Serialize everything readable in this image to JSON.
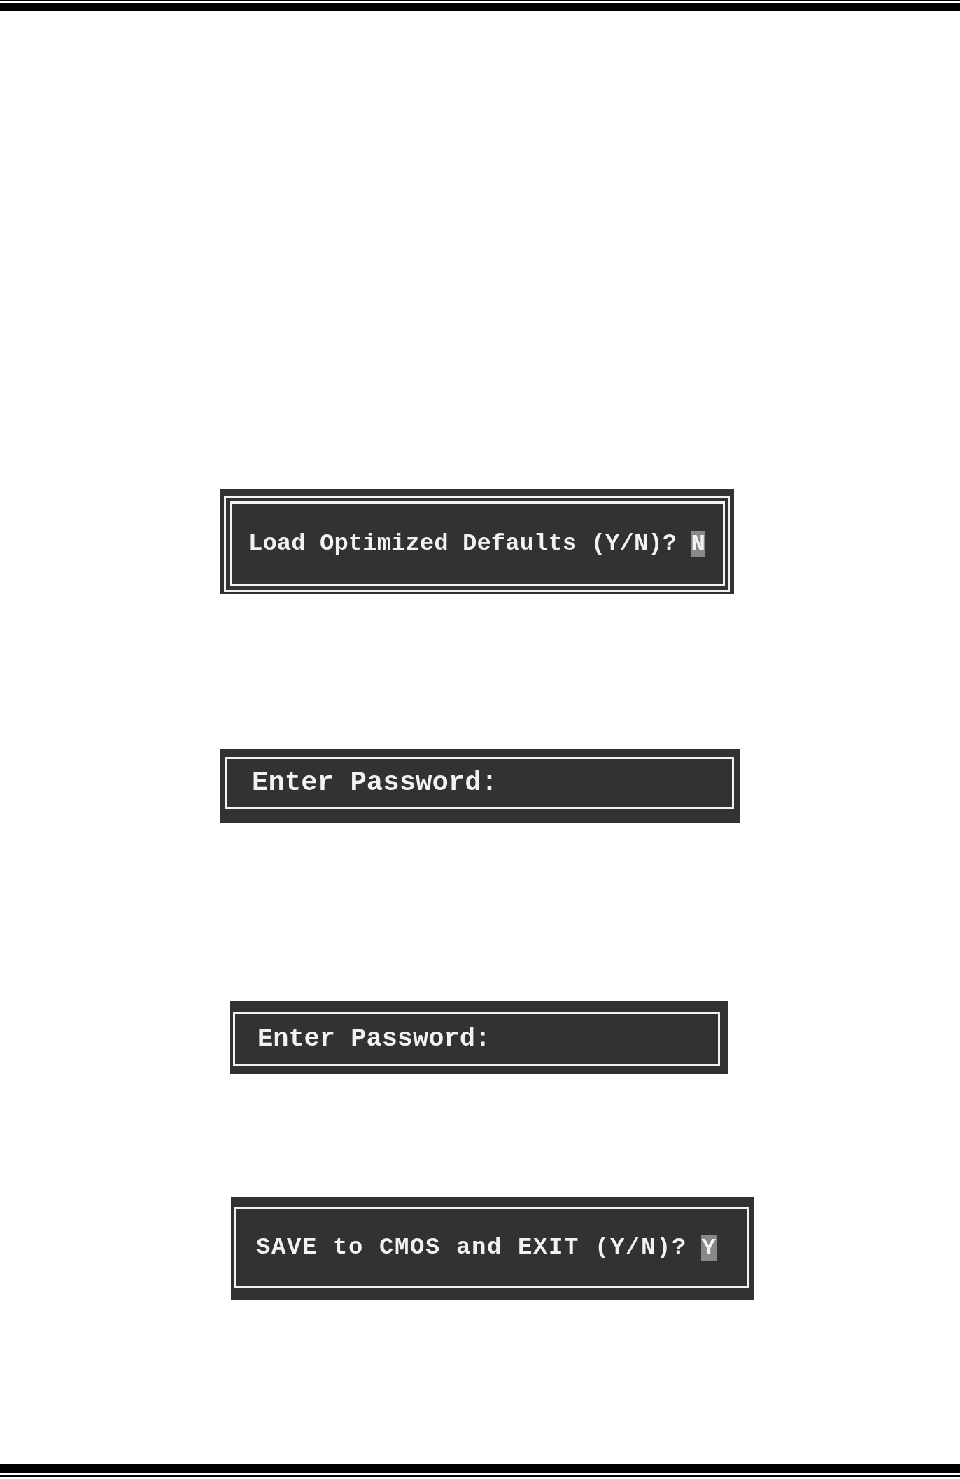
{
  "dialogs": [
    {
      "kind": "confirm",
      "prompt": "Load Optimized Defaults (Y/N)?",
      "answer": "N"
    },
    {
      "kind": "password",
      "prompt": "Enter Password:"
    },
    {
      "kind": "password",
      "prompt": "Enter Password:"
    },
    {
      "kind": "confirm",
      "prompt": "SAVE to CMOS and EXIT (Y/N)?",
      "answer": "Y"
    }
  ]
}
